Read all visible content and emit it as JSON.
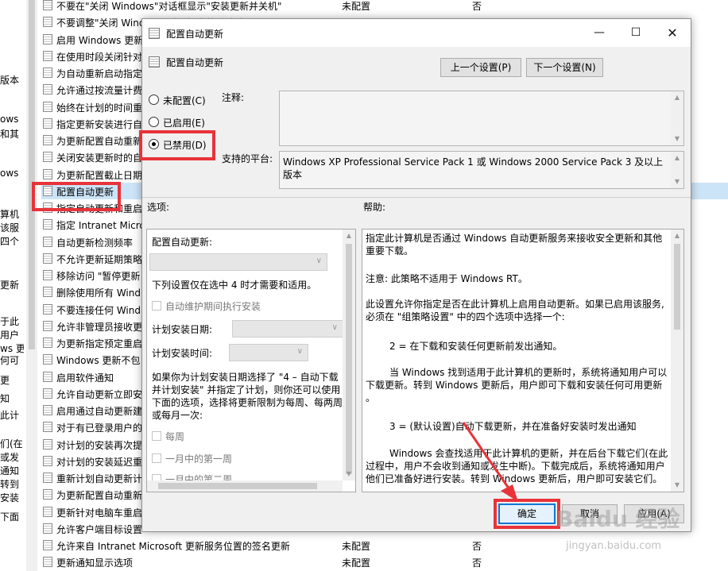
{
  "background": {
    "left_fragments": [
      "版本",
      "ows",
      "和其",
      "ows",
      "算机",
      "该服",
      "四个",
      "更新",
      "于此",
      "用户",
      "ws 更",
      "何可",
      "更",
      "知",
      "此计",
      "们(在",
      "或发",
      "通知",
      "转到",
      "安装",
      "下面"
    ],
    "rows": [
      {
        "name": "不要在\"关闭 Windows\"对话框显示\"安装更新并关机\"",
        "state": "未配置",
        "comment": "否"
      },
      {
        "name": "不要调整\"关闭 Windows\"对话框中的默认选项",
        "state": "",
        "comment": ""
      },
      {
        "name": "启用 Windows 更新电源管理",
        "state": "",
        "comment": ""
      },
      {
        "name": "在使用时段关闭针对",
        "state": "",
        "comment": ""
      },
      {
        "name": "为自动重新启动指定",
        "state": "",
        "comment": ""
      },
      {
        "name": "允许通过按流量计费",
        "state": "",
        "comment": ""
      },
      {
        "name": "始终在计划的时间重",
        "state": "",
        "comment": ""
      },
      {
        "name": "指定更新安装进行自",
        "state": "",
        "comment": ""
      },
      {
        "name": "为更新配置自动重新",
        "state": "",
        "comment": ""
      },
      {
        "name": "关闭安装更新时的自",
        "state": "",
        "comment": ""
      },
      {
        "name": "为更新配置截止日期",
        "state": "",
        "comment": ""
      },
      {
        "name": "配置自动更新",
        "state": "",
        "comment": ""
      },
      {
        "name": "指定自动更新和重启",
        "state": "",
        "comment": ""
      },
      {
        "name": "指定 Intranet Micro",
        "state": "",
        "comment": ""
      },
      {
        "name": "自动更新检测频率",
        "state": "",
        "comment": ""
      },
      {
        "name": "不允许更新延期策略",
        "state": "",
        "comment": ""
      },
      {
        "name": "移除访问 \"暂停更新",
        "state": "",
        "comment": ""
      },
      {
        "name": "删除使用所有 Wind",
        "state": "",
        "comment": ""
      },
      {
        "name": "不要连接任何 Wind",
        "state": "",
        "comment": ""
      },
      {
        "name": "允许非管理员接收更",
        "state": "",
        "comment": ""
      },
      {
        "name": "为更新指定预定重启",
        "state": "",
        "comment": ""
      },
      {
        "name": "Windows 更新不包",
        "state": "",
        "comment": ""
      },
      {
        "name": "启用软件通知",
        "state": "",
        "comment": ""
      },
      {
        "name": "允许自动更新立即安",
        "state": "",
        "comment": ""
      },
      {
        "name": "启用通过自动更新建",
        "state": "",
        "comment": ""
      },
      {
        "name": "对于有已登录用户的",
        "state": "",
        "comment": ""
      },
      {
        "name": "对计划的安装再次提",
        "state": "",
        "comment": ""
      },
      {
        "name": "对计划的安装延迟重",
        "state": "",
        "comment": ""
      },
      {
        "name": "重新计划自动更新计",
        "state": "",
        "comment": ""
      },
      {
        "name": "为更新配置自动重新",
        "state": "",
        "comment": ""
      },
      {
        "name": "更新针对电脑车重启",
        "state": "",
        "comment": ""
      },
      {
        "name": "允许客户端目标设置",
        "state": "",
        "comment": ""
      },
      {
        "name": "允许来自 Intranet Microsoft 更新服务位置的签名更新",
        "state": "未配置",
        "comment": "否"
      },
      {
        "name": "更新通知显示选项",
        "state": "未配置",
        "comment": "否"
      }
    ]
  },
  "dialog": {
    "title": "配置自动更新",
    "header_label": "配置自动更新",
    "prev_button": "上一个设置(P)",
    "next_button": "下一个设置(N)",
    "radios": [
      {
        "label": "未配置(C)",
        "selected": false
      },
      {
        "label": "已启用(E)",
        "selected": false
      },
      {
        "label": "已禁用(D)",
        "selected": true
      }
    ],
    "comment_label": "注释:",
    "comment_value": "",
    "platform_label": "支持的平台:",
    "platform_value": "Windows XP Professional Service Pack 1 或 Windows 2000 Service Pack 3 及以上版本",
    "options_label": "选项:",
    "help_label": "帮助:",
    "options": {
      "configure_label": "配置自动更新:",
      "note": "下列设置仅在选中 4 时才需要和适用。",
      "maintenance_checkbox": "自动维护期间执行安装",
      "schedule_day_label": "计划安装日期:",
      "schedule_time_label": "计划安装时间:",
      "explain_1": "如果你为计划安装日期选择了 \"4 – 自动下载",
      "explain_2": "并计划安装\" 并指定了计划，则你还可以使用",
      "explain_3": "下面的选项，选择将更新限制为每周、每两周",
      "explain_4": "或每月一次:",
      "weekly": "每周",
      "first_week": "一月中的第一周",
      "second_week": "一月中的第二周"
    },
    "help": {
      "p1a": "指定此计算机是否通过 Windows 自动更新服务来接收安全更新和其他",
      "p1b": "重要下载。",
      "p2": "注意: 此策略不适用于 Windows RT。",
      "p3a": "此设置允许你指定是否在此计算机上启用自动更新。如果已启用该服务,",
      "p3b": "必须在 \"组策略设置\" 中的四个选项中选择一个:",
      "p4": "2 = 在下载和安装任何更新前发出通知。",
      "p5a": "当 Windows 找到适用于此计算机的更新时，系统将通知用户可以",
      "p5b": "下载更新。转到 Windows 更新后，用户即可下载和安装任何可用更新",
      "p5c": "。",
      "p6": "3 = (默认设置)自动下载更新，并在准备好安装时发出通知",
      "p7a": "Windows 会查找适用于此计算机的更新，并在后台下载它们(在此",
      "p7b": "过程中，用户不会收到通知或发生中断)。下载完成后，系统将通知用户",
      "p7c": "他们已准备好进行安装。转到 Windows 更新后，用户即可安装它们。"
    },
    "ok_button": "确定",
    "cancel_button": "取消",
    "apply_button": "应用(A)"
  },
  "watermark": {
    "line1": "Baidu 经验",
    "line2": "jingyan.baidu.com"
  },
  "colors": {
    "highlight": "#e8333a",
    "accent": "#0078d7"
  }
}
